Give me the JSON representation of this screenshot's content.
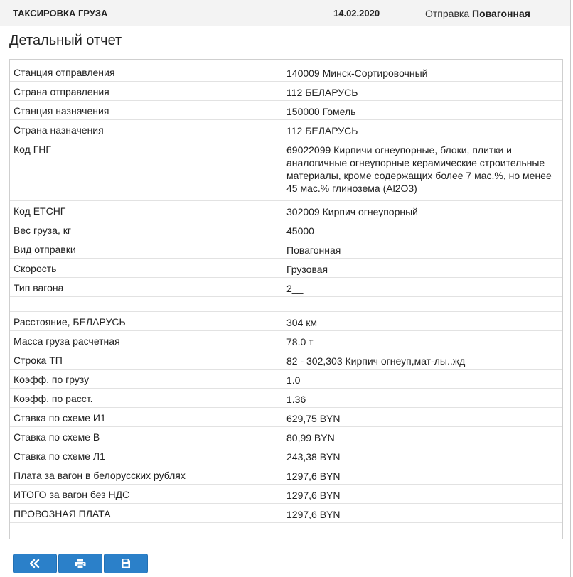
{
  "header": {
    "title": "ТАКСИРОВКА ГРУЗА",
    "date": "14.02.2020",
    "shipment_label": "Отправка",
    "shipment_value": "Повагонная"
  },
  "report": {
    "heading": "Детальный отчет",
    "rows": [
      {
        "key": "Станция отправления",
        "value": "140009 Минск-Сортировочный"
      },
      {
        "key": "Страна отправления",
        "value": "112 БЕЛАРУСЬ"
      },
      {
        "key": "Станция назначения",
        "value": "150000 Гомель"
      },
      {
        "key": "Страна назначения",
        "value": "112 БЕЛАРУСЬ"
      },
      {
        "key": "Код ГНГ",
        "value": "69022099 Кирпичи огнеупорные, блоки, плитки и аналогичные огнеупорные керамические строительные материалы, кроме содержащих более 7 мас.%, но менее 45 мас.% глинозема (Al2O3)"
      },
      {
        "key": "Код ЕТСНГ",
        "value": "302009 Кирпич огнеупорный"
      },
      {
        "key": "Вес груза, кг",
        "value": "45000"
      },
      {
        "key": "Вид отправки",
        "value": "Повагонная"
      },
      {
        "key": "Скорость",
        "value": "Грузовая"
      },
      {
        "key": "Тип вагона",
        "value": "2__"
      },
      {
        "key": "",
        "value": ""
      },
      {
        "key": "Расстояние, БЕЛАРУСЬ",
        "value": "304 км"
      },
      {
        "key": "Масса груза расчетная",
        "value": "78.0 т"
      },
      {
        "key": "Строка ТП",
        "value": "82 - 302,303 Кирпич огнеуп,мат-лы..жд"
      },
      {
        "key": "Коэфф. по грузу",
        "value": "1.0"
      },
      {
        "key": "Коэфф. по расст.",
        "value": "1.36"
      },
      {
        "key": "Ставка по схеме И1",
        "value": "629,75 BYN"
      },
      {
        "key": "Ставка по схеме В",
        "value": "80,99 BYN"
      },
      {
        "key": "Ставка по схеме Л1",
        "value": "243,38 BYN"
      },
      {
        "key": "Плата за вагон в белорусских рублях",
        "value": "1297,6 BYN"
      },
      {
        "key": "ИТОГО за вагон без НДС",
        "value": "1297,6 BYN"
      },
      {
        "key": "ПРОВОЗНАЯ ПЛАТА",
        "value": "1297,6 BYN"
      }
    ]
  },
  "buttons": {
    "back_icon": "double-chevron-left-icon",
    "print_icon": "printer-icon",
    "save_icon": "floppy-disk-icon",
    "color": "#2b80c9"
  }
}
